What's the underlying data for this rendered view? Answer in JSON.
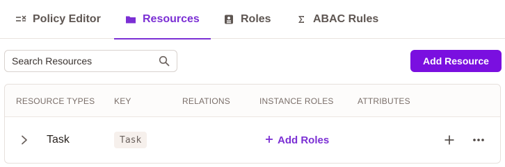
{
  "tabs": {
    "policy_editor": {
      "label": "Policy Editor",
      "icon": "policy-editor-icon"
    },
    "resources": {
      "label": "Resources",
      "icon": "folder-icon",
      "active": true
    },
    "roles": {
      "label": "Roles",
      "icon": "id-card-icon"
    },
    "abac_rules": {
      "label": "ABAC Rules",
      "icon": "sigma-icon"
    }
  },
  "search": {
    "placeholder": "Search Resources",
    "value": ""
  },
  "toolbar": {
    "add_resource_label": "Add Resource"
  },
  "table": {
    "headers": {
      "resource_types": "RESOURCE TYPES",
      "key": "KEY",
      "relations": "RELATIONS",
      "instance_roles": "INSTANCE ROLES",
      "attributes": "ATTRIBUTES"
    },
    "rows": [
      {
        "name": "Task",
        "key": "Task",
        "add_roles_label": "Add Roles"
      }
    ]
  },
  "colors": {
    "accent": "#7b2fd4",
    "primary_button": "#7a0fe0",
    "key_badge_bg": "#f6f0ec"
  }
}
